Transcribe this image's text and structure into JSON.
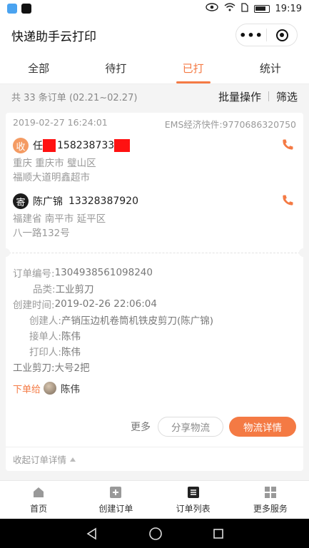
{
  "status_bar": {
    "time": "19:19"
  },
  "header": {
    "title": "快递助手云打印"
  },
  "tabs": [
    {
      "label": "全部"
    },
    {
      "label": "待打"
    },
    {
      "label": "已打"
    },
    {
      "label": "统计"
    }
  ],
  "summary": {
    "count_text": "共 33 条订单 (02.21~02.27)",
    "batch_label": "批量操作",
    "filter_label": "筛选"
  },
  "order": {
    "datetime": "2019-02-27 16:24:01",
    "carrier": "EMS经济快件:9770686320750",
    "receiver": {
      "badge": "收",
      "name": "任",
      "phone": "158238733",
      "address_line1": "重庆 重庆市 璧山区",
      "address_line2": "福顺大道明鑫超市"
    },
    "sender": {
      "badge": "寄",
      "name": "陈广锦",
      "phone": "13328387920",
      "address_line1": "福建省 南平市 延平区",
      "address_line2": "八一路132号"
    },
    "details": [
      {
        "label": "订单编号:",
        "value": "1304938561098240"
      },
      {
        "label": "品类:",
        "value": "工业剪刀"
      },
      {
        "label": "创建时间:",
        "value": "2019-02-26 22:06:04"
      },
      {
        "label": "创建人:",
        "value": "产销压边机卷筒机铁皮剪刀(陈广锦)"
      },
      {
        "label": "接单人:",
        "value": "陈伟"
      },
      {
        "label": "打印人:",
        "value": "陈伟"
      }
    ],
    "item_note": "工业剪刀:大号2把",
    "assign_label": "下单给",
    "assign_to": "陈伟",
    "more_label": "更多",
    "share_label": "分享物流",
    "track_label": "物流详情",
    "collapse_label": "收起订单详情"
  },
  "bottom_nav": [
    {
      "label": "首页"
    },
    {
      "label": "创建订单"
    },
    {
      "label": "订单列表"
    },
    {
      "label": "更多服务"
    }
  ],
  "colors": {
    "accent": "#f47a44",
    "redaction": "#ff1111"
  }
}
